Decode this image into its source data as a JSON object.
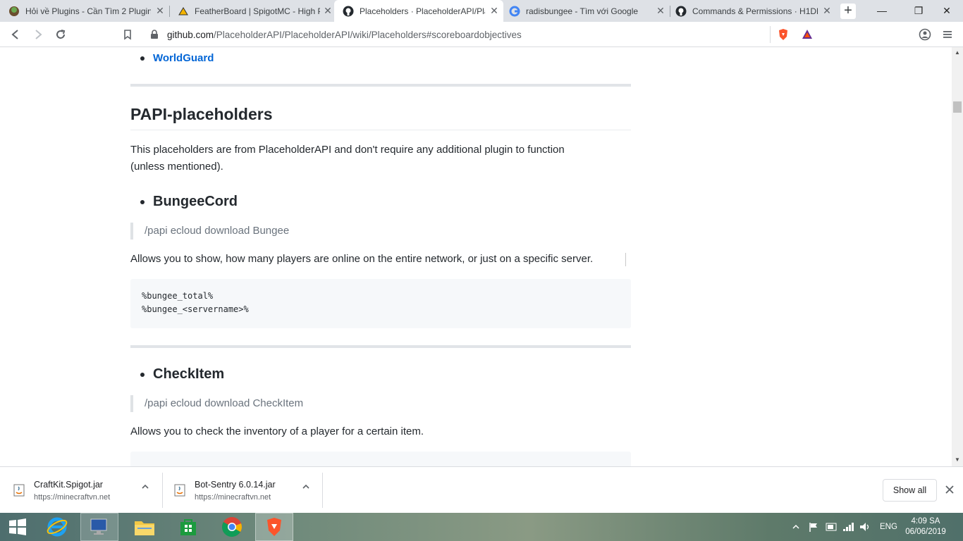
{
  "tabs": [
    {
      "title": "Hỏi về Plugins - Cần Tìm 2 Plugin",
      "icon": "minecraft-icon",
      "active": false
    },
    {
      "title": "FeatherBoard | SpigotMC - High P",
      "icon": "spigot-icon",
      "active": false
    },
    {
      "title": "Placeholders · PlaceholderAPI/Pla",
      "icon": "github-icon",
      "active": true
    },
    {
      "title": "radisbungee - Tìm với Google",
      "icon": "google-icon",
      "active": false
    },
    {
      "title": "Commands & Permissions · H1DD",
      "icon": "github-icon",
      "active": false
    }
  ],
  "toolbar": {
    "url_host": "github.com",
    "url_path": "/PlaceholderAPI/PlaceholderAPI/wiki/Placeholders#scoreboardobjectives"
  },
  "page": {
    "top_list_item": "WorldGuard",
    "section_heading": "PAPI-placeholders",
    "section_intro_line1": "This placeholders are from PlaceholderAPI and don't require any additional plugin to function",
    "section_intro_line2": "(unless mentioned).",
    "items": [
      {
        "heading": "BungeeCord",
        "quote": "/papi ecloud download Bungee",
        "description": "Allows you to show, how many players are online on the entire network, or just on a specific server.",
        "code": [
          "%bungee_total%",
          "%bungee_<servername>%"
        ]
      },
      {
        "heading": "CheckItem",
        "quote": "/papi ecloud download CheckItem",
        "description": "Allows you to check the inventory of a player for a certain item."
      }
    ]
  },
  "downloads": [
    {
      "filename": "CraftKit.Spigot.jar",
      "source": "https://minecraftvn.net"
    },
    {
      "filename": "Bot-Sentry 6.0.14.jar",
      "source": "https://minecraftvn.net"
    }
  ],
  "download_shelf": {
    "show_all_label": "Show all"
  },
  "taskbar": {
    "language": "ENG",
    "time": "4:09 SA",
    "date": "06/06/2019"
  },
  "colors": {
    "link": "#0366d6",
    "chrome_tabstrip": "#dee1e6",
    "code_bg": "#f6f8fa"
  }
}
